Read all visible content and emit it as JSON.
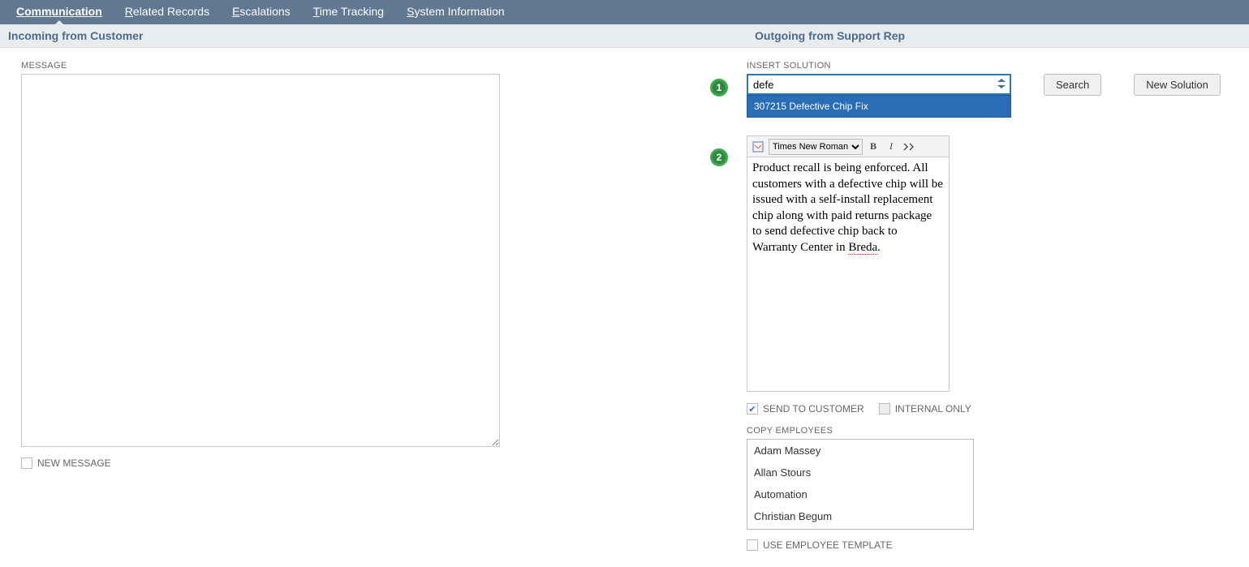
{
  "tabs": {
    "communication": "Communication",
    "related_records": "Related Records",
    "escalations": "Escalations",
    "time_tracking": "Time Tracking",
    "system_information": "System Information"
  },
  "sections": {
    "incoming": "Incoming from Customer",
    "outgoing": "Outgoing from Support Rep"
  },
  "incoming": {
    "message_label": "MESSAGE",
    "message_value": "",
    "new_message_label": "NEW MESSAGE"
  },
  "outgoing": {
    "insert_solution_label": "INSERT SOLUTION",
    "insert_solution_value": "defe",
    "dropdown_option": "307215 Defective Chip Fix",
    "search_button": "Search",
    "new_solution_button": "New Solution",
    "editor_font": "Times New Roman",
    "editor_body_prefix": "Product recall is being enforced. All customers with a defective chip will be issued with a self-install replacement chip along with paid returns package to send defective chip back to Warranty Center in ",
    "editor_body_underlined": "Breda",
    "editor_body_suffix": ".",
    "send_to_customer_label": "SEND TO CUSTOMER",
    "internal_only_label": "INTERNAL ONLY",
    "copy_employees_label": "COPY EMPLOYEES",
    "employees": {
      "0": "Adam Massey",
      "1": "Allan Stours",
      "2": "Automation",
      "3": "Christian Begum"
    },
    "use_employee_template_label": "USE EMPLOYEE TEMPLATE"
  },
  "badges": {
    "one": "1",
    "two": "2"
  }
}
